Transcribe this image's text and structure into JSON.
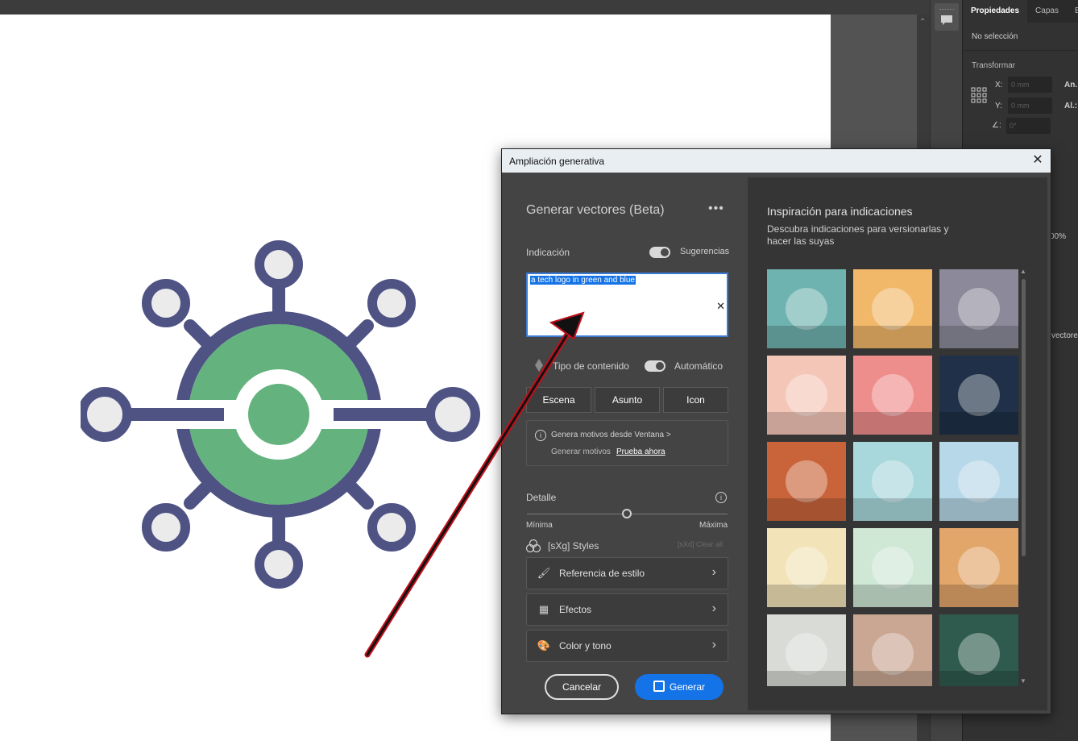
{
  "properties_panel": {
    "tabs": [
      "Propiedades",
      "Capas",
      "Bib"
    ],
    "no_selection": "No selección",
    "transform_label": "Transformar",
    "x_label": "X:",
    "y_label": "Y:",
    "width_label": "An.:",
    "height_label": "Al.:",
    "x_placeholder": "0 mm",
    "y_placeholder": "0 mm",
    "angle_placeholder": "0°",
    "partial_percent": "00%",
    "partial_vectors": "vectores"
  },
  "dialog": {
    "title": "Ampliación generativa",
    "heading": "Generar vectores (Beta)",
    "prompt_label": "Indicación",
    "suggestions_label": "Sugerencias",
    "prompt_value": "a tech logo in green and blue",
    "content_type_label": "Tipo de contenido",
    "auto_label": "Automático",
    "segments": [
      "Escena",
      "Asunto",
      "Icon"
    ],
    "info_line1": "Genera motivos desde Ventana >",
    "info_line2": "Generar motivos",
    "info_link": "Prueba ahora",
    "detail_label": "Detalle",
    "detail_min": "Mínima",
    "detail_max": "Máxima",
    "detail_level": 0.5,
    "styles_label": "[sXg] Styles",
    "styles_clear": "[sXd] Clear all",
    "accordions": [
      "Referencia de estilo",
      "Efectos",
      "Color y tono"
    ],
    "cancel_label": "Cancelar",
    "generate_label": "Generar"
  },
  "inspiration": {
    "title": "Inspiración para indicaciones",
    "subtitle": "Descubra indicaciones para versionarlas y hacer las suyas",
    "thumbnails": [
      {
        "name": "tree-thumb",
        "bg": "#6fb3b0"
      },
      {
        "name": "jellyfish-thumb",
        "bg": "#f2b86a"
      },
      {
        "name": "horse-thumb",
        "bg": "#8c8a9a"
      },
      {
        "name": "dog-thumb",
        "bg": "#f4c6b8"
      },
      {
        "name": "star-badge-thumb",
        "bg": "#ee8e8c"
      },
      {
        "name": "mask-thumb",
        "bg": "#1f3048"
      },
      {
        "name": "city-sunset-thumb",
        "bg": "#c9643a"
      },
      {
        "name": "weather-thumb",
        "bg": "#a9d8dc"
      },
      {
        "name": "unicorn-thumb",
        "bg": "#b7d8e8"
      },
      {
        "name": "clock-tower-thumb",
        "bg": "#f2e3b8"
      },
      {
        "name": "tiger-thumb",
        "bg": "#cfe7d5"
      },
      {
        "name": "cafe-thumb",
        "bg": "#e2a66a"
      },
      {
        "name": "kitchen-thumb",
        "bg": "#d8dbd6"
      },
      {
        "name": "gramophone-thumb",
        "bg": "#c9a793"
      },
      {
        "name": "forest-thumb",
        "bg": "#2f5b4e"
      }
    ]
  },
  "colors": {
    "logo_purple": "#4f5384",
    "logo_green": "#64b37e",
    "accent_blue": "#1473e6",
    "arrow_red": "#c0101c"
  }
}
